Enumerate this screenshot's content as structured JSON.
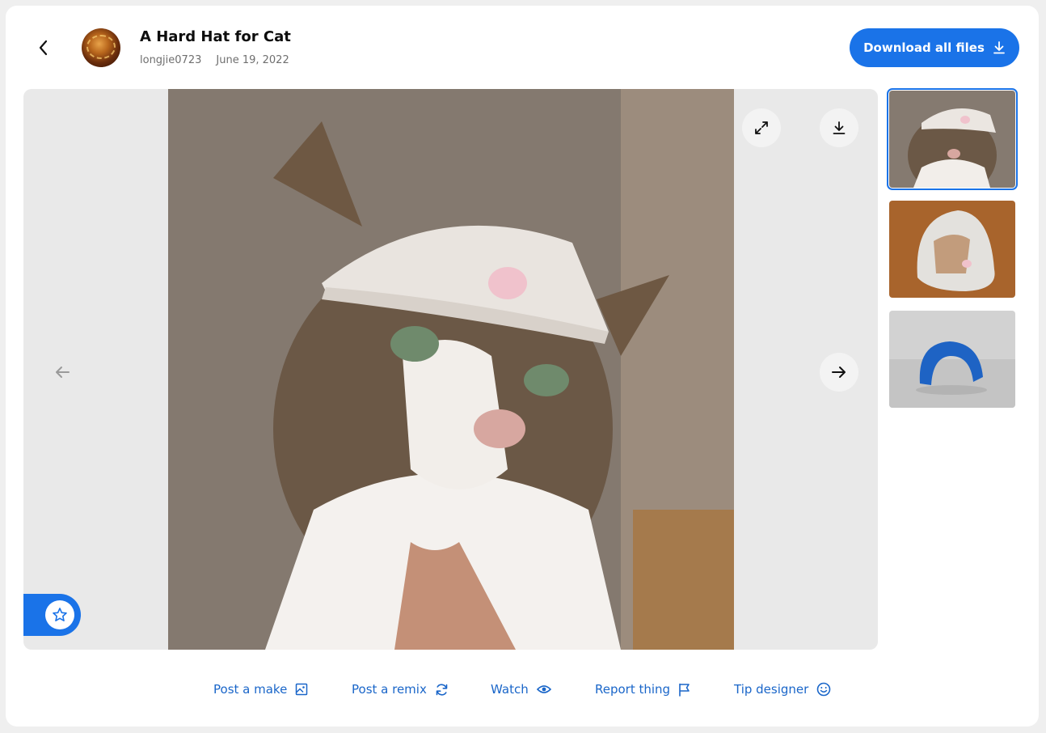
{
  "header": {
    "title": "A Hard Hat for Cat",
    "author": "longjie0723",
    "date": "June 19, 2022",
    "download_all_label": "Download all files"
  },
  "icons": {
    "back": "chevron-left-icon",
    "download": "download-icon",
    "expand": "expand-icon",
    "next": "arrow-right-icon",
    "prev": "arrow-left-icon",
    "favorite": "star-icon"
  },
  "colors": {
    "accent": "#1a73e8",
    "link": "#1a66c9",
    "page_bg": "#efefef"
  },
  "actions": [
    {
      "label": "Post a make",
      "icon": "image-icon"
    },
    {
      "label": "Post a remix",
      "icon": "refresh-icon"
    },
    {
      "label": "Watch",
      "icon": "eye-icon"
    },
    {
      "label": "Report thing",
      "icon": "flag-icon"
    },
    {
      "label": "Tip designer",
      "icon": "smile-icon"
    }
  ]
}
